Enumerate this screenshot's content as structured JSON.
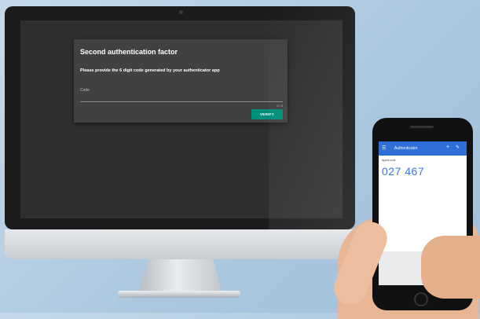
{
  "dialog": {
    "title": "Second authentication factor",
    "message": "Please provide the 6 digit code generated by your authenticator app",
    "code_label": "Code",
    "code_value": "",
    "counter": "0 / 6",
    "verify_label": "VERIFY"
  },
  "phone_app": {
    "title": "Authenticator",
    "account": "Appid:code",
    "code": "027 467",
    "accent_color": "#2f6fd8"
  },
  "colors": {
    "verify_button": "#008f7a",
    "dialog_bg": "#414141",
    "screen_bg": "#2f2f2f"
  }
}
